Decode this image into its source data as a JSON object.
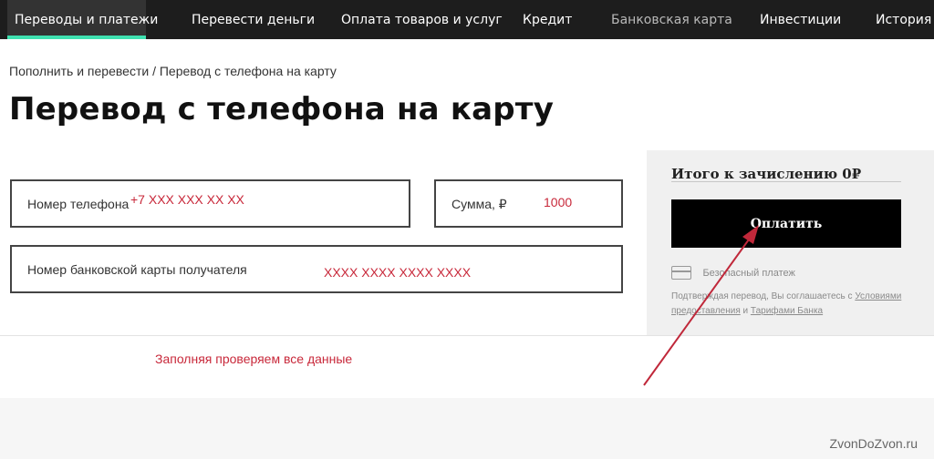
{
  "nav": {
    "items": [
      {
        "label": "Переводы и платежи"
      },
      {
        "label": "Перевести деньги"
      },
      {
        "label": "Оплата товаров и услуг"
      },
      {
        "label": "Кредит"
      },
      {
        "label": "Банковская карта"
      },
      {
        "label": "Инвестиции"
      },
      {
        "label": "История"
      }
    ],
    "accent_color": "#3fe1b0"
  },
  "breadcrumb": "Пополнить и перевести / Перевод с телефона на карту",
  "page_title": "Перевод с телефона на карту",
  "form": {
    "phone_label": "Номер телефона",
    "phone_value": "+7 XXX XXX XX XX",
    "amount_label": "Сумма, ₽",
    "amount_value": "1000",
    "card_label": "Номер банковской карты получателя",
    "card_value": "XXXX XXXX XXXX XXXX"
  },
  "summary": {
    "title": "Итого к зачислению 0₽",
    "pay_button": "Оплатить",
    "secure_text": "Безопасный платеж",
    "legal_prefix": "Подтверждая перевод, Вы соглашаетесь с",
    "legal_link1": "Условиями предоставления",
    "legal_and": "и",
    "legal_link2": "Тарифами Банка"
  },
  "annotation_note": "Заполняя проверяем все данные",
  "watermark": "ZvonDoZvon.ru",
  "colors": {
    "annotation": "#c8283a",
    "arrow": "#c0283a"
  }
}
